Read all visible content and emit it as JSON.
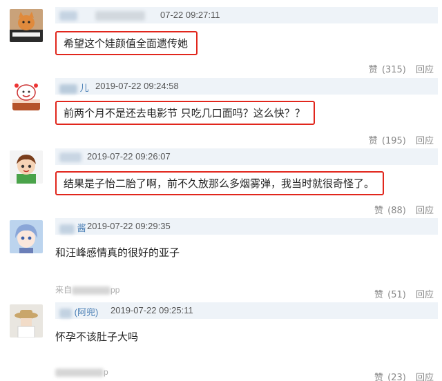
{
  "comments": [
    {
      "name": "",
      "time": "07-22 09:27:11",
      "text": "希望这个娃颜值全面遗传她",
      "likes_label": "赞",
      "likes_count": "(315)",
      "reply_label": "回应",
      "avatar": "cat-piano-avatar",
      "boxed": true
    },
    {
      "name": "儿",
      "time": "2019-07-22 09:24:58",
      "text": "前两个月不是还去电影节 只吃几口面吗？这么快？？",
      "likes_label": "赞",
      "likes_count": "(195)",
      "reply_label": "回应",
      "avatar": "cartoon-cake-avatar",
      "boxed": true
    },
    {
      "name": "",
      "time": "2019-07-22 09:26:07",
      "text": "结果是子怡二胎了啊，前不久放那么多烟雾弹，我当时就很奇怪了。",
      "likes_label": "赞",
      "likes_count": "(88)",
      "reply_label": "回应",
      "avatar": "cartoon-boy-avatar",
      "boxed": true
    },
    {
      "name": "酱",
      "time": "2019-07-22 09:29:35",
      "text": "和汪峰感情真的很好的亚子",
      "likes_label": "赞",
      "likes_count": "(51)",
      "reply_label": "回应",
      "avatar": "anime-girl-avatar",
      "boxed": false,
      "source": "来自",
      "source_suffix": "pp"
    },
    {
      "name": "(阿兜)",
      "time": "2019-07-22 09:25:11",
      "text": "怀孕不该肚子大吗",
      "likes_label": "赞",
      "likes_count": "(23)",
      "reply_label": "回应",
      "avatar": "straw-hat-avatar",
      "boxed": false,
      "source": "",
      "source_suffix": "p"
    }
  ],
  "colors": {
    "highlight_border": "#e1261c",
    "meta_bar": "#eef3f8",
    "name_link": "#4a7fb5"
  }
}
